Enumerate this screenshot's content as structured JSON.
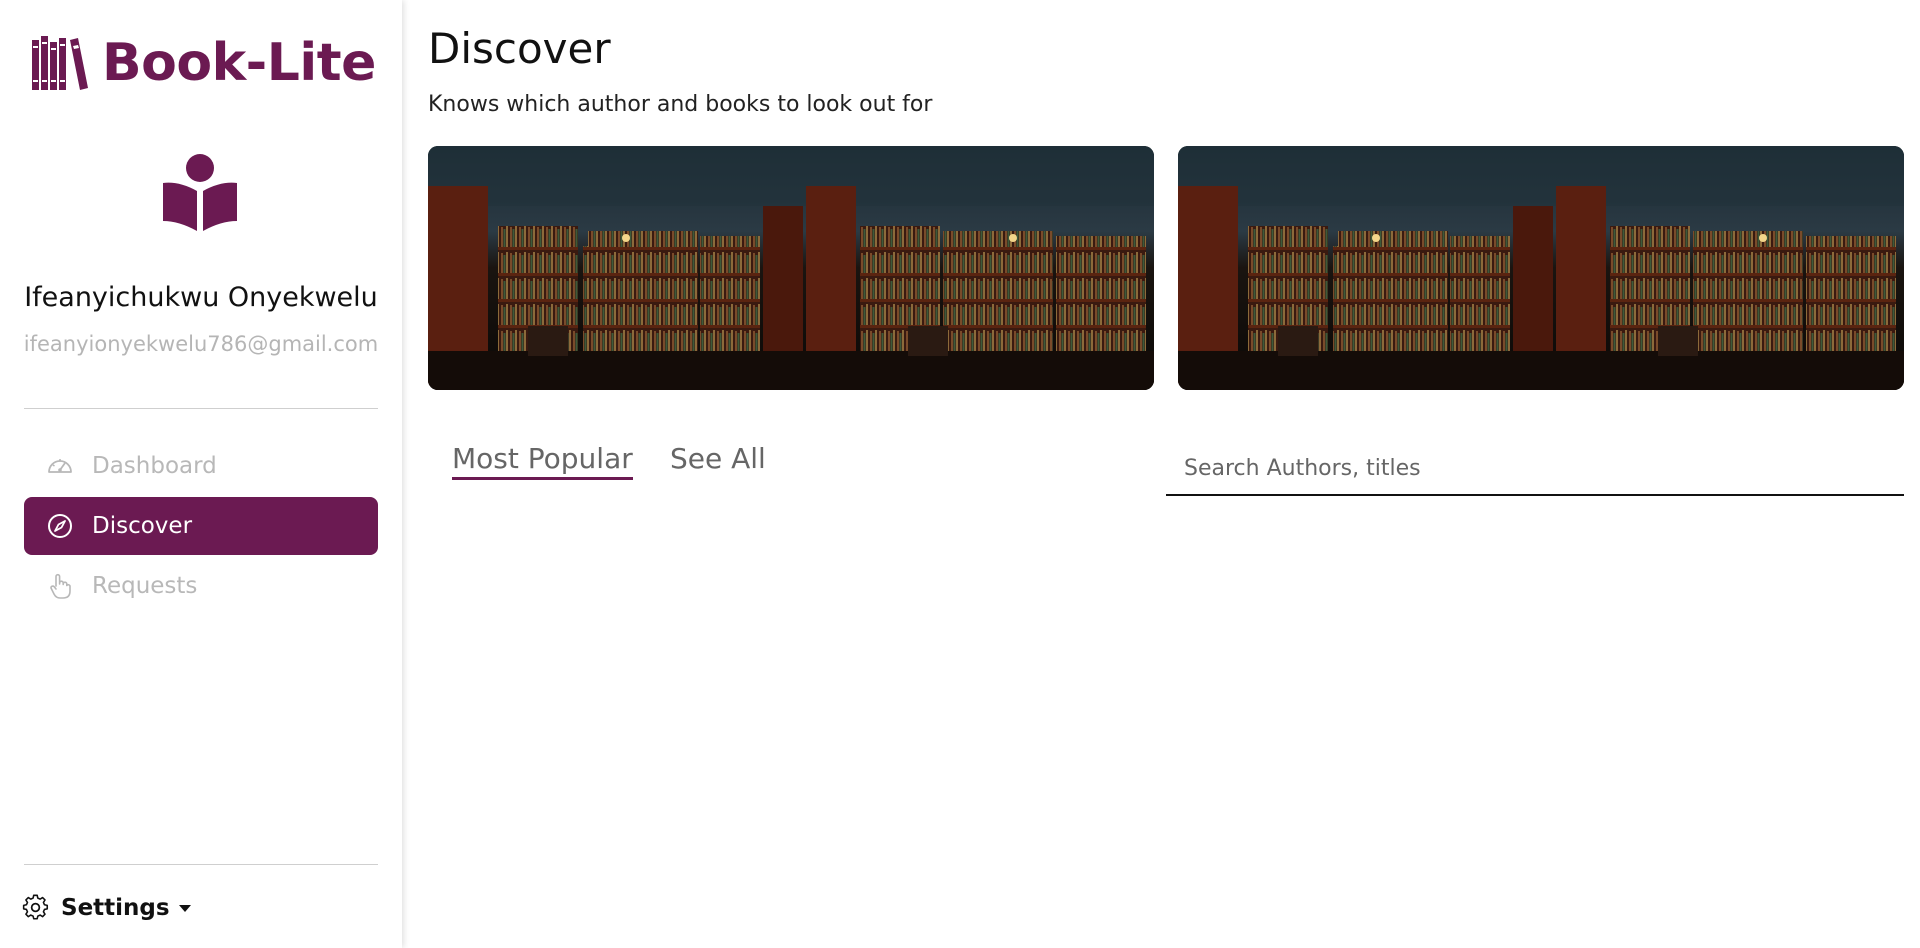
{
  "brand": {
    "name": "Book-Lite",
    "color": "#6b1a52",
    "icon": "books-icon"
  },
  "user": {
    "avatar_icon": "reader-icon",
    "name": "Ifeanyichukwu Onyekwelu",
    "email": "ifeanyionyekwelu786@gmail.com"
  },
  "nav": {
    "items": [
      {
        "label": "Dashboard",
        "icon": "speedometer-icon",
        "active": false
      },
      {
        "label": "Discover",
        "icon": "compass-icon",
        "active": true
      },
      {
        "label": "Requests",
        "icon": "hand-pointer-icon",
        "active": false
      }
    ]
  },
  "settings": {
    "label": "Settings",
    "icon": "gear-icon",
    "caret_icon": "caret-down-icon"
  },
  "main": {
    "title": "Discover",
    "subtitle": "Knows which author and books to look out for",
    "banners": [
      {
        "image": "library-bookshelves-image"
      },
      {
        "image": "library-bookshelves-image"
      }
    ],
    "tabs": [
      {
        "label": "Most Popular",
        "active": true
      },
      {
        "label": "See All",
        "active": false
      }
    ],
    "search": {
      "placeholder": "Search Authors, titles",
      "value": ""
    }
  },
  "colors": {
    "accent": "#6b1a52",
    "muted_text": "#b5b5b5",
    "sidebar_bg": "#ffffff"
  }
}
